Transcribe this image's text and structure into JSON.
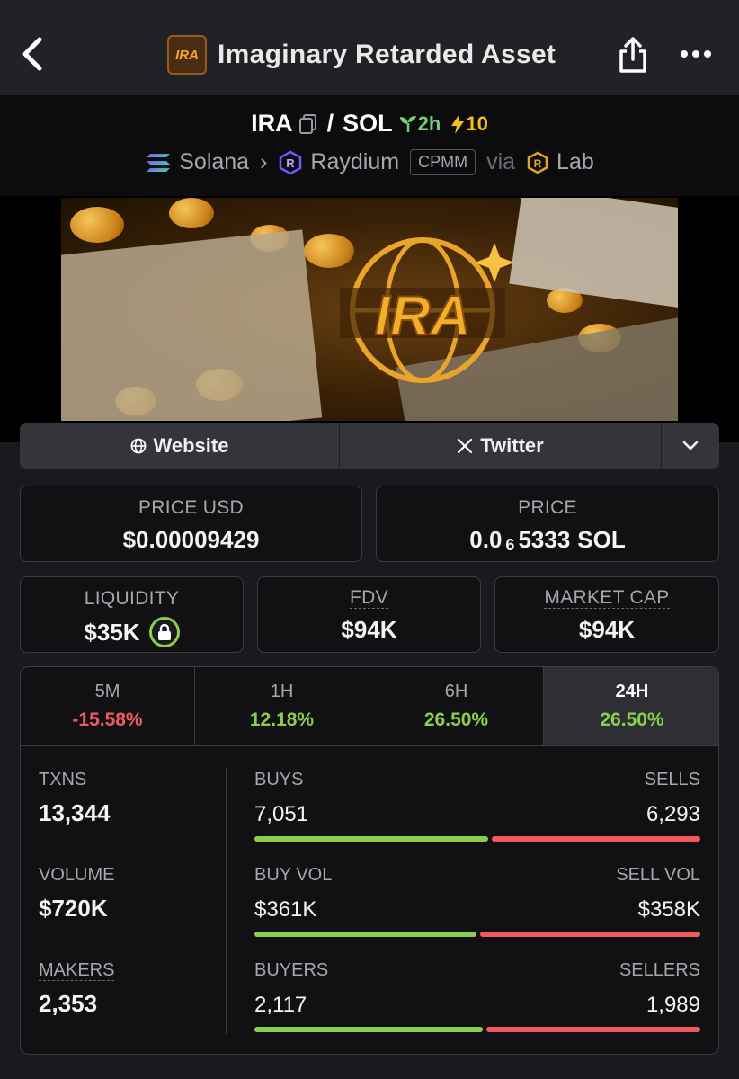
{
  "header": {
    "logo_text": "IRA",
    "title": "Imaginary Retarded Asset"
  },
  "pair": {
    "base": "IRA",
    "separator": "/",
    "quote": "SOL",
    "age": "2h",
    "boosts": "10",
    "chain": "Solana",
    "dex": "Raydium",
    "pool_type": "CPMM",
    "via_label": "via",
    "launchpad": "Lab"
  },
  "banner": {
    "logo_text": "IRA"
  },
  "links": {
    "website": "Website",
    "twitter": "Twitter"
  },
  "price_usd": {
    "label": "PRICE USD",
    "value": "$0.00009429"
  },
  "price_native": {
    "label": "PRICE",
    "prefix": "0.0",
    "zeros": "6",
    "digits": "5333",
    "unit": "SOL"
  },
  "liquidity": {
    "label": "LIQUIDITY",
    "value": "$35K"
  },
  "fdv": {
    "label": "FDV",
    "value": "$94K"
  },
  "market_cap": {
    "label": "MARKET CAP",
    "value": "$94K"
  },
  "timeframes": [
    {
      "label": "5M",
      "change": "-15.58%"
    },
    {
      "label": "1H",
      "change": "12.18%"
    },
    {
      "label": "6H",
      "change": "26.50%"
    },
    {
      "label": "24H",
      "change": "26.50%"
    }
  ],
  "stats": {
    "txns": {
      "label": "TXNS",
      "value": "13,344"
    },
    "volume": {
      "label": "VOLUME",
      "value": "$720K"
    },
    "makers": {
      "label": "MAKERS",
      "value": "2,353"
    },
    "buys": {
      "label": "BUYS",
      "value": "7,051",
      "share": 0.528
    },
    "sells": {
      "label": "SELLS",
      "value": "6,293"
    },
    "buy_vol": {
      "label": "BUY VOL",
      "value": "$361K",
      "share": 0.502
    },
    "sell_vol": {
      "label": "SELL VOL",
      "value": "$358K"
    },
    "buyers": {
      "label": "BUYERS",
      "value": "2,117",
      "share": 0.516
    },
    "sellers": {
      "label": "SELLERS",
      "value": "1,989"
    }
  },
  "colors": {
    "positive": "#8ccf4c",
    "negative": "#ef5a5e",
    "boost": "#f3c316",
    "age": "#6fcf73"
  }
}
